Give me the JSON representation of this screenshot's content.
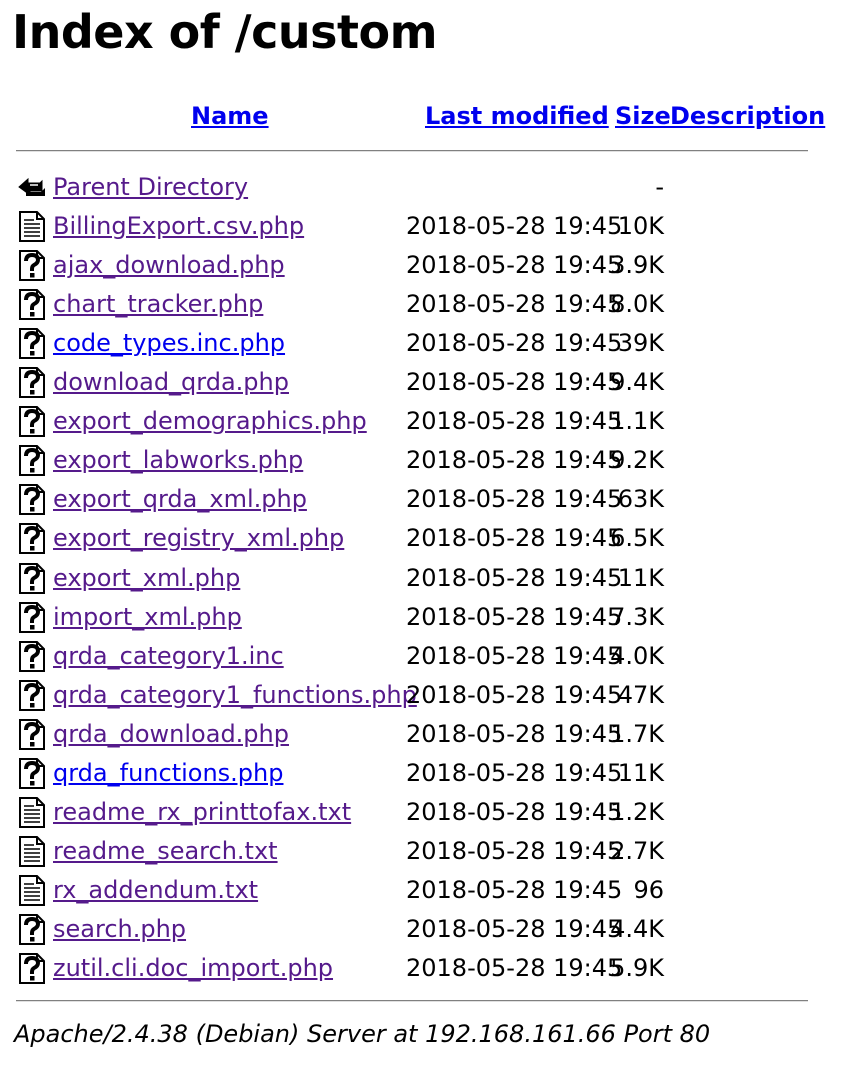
{
  "page": {
    "title": "Index of /custom"
  },
  "columns": {
    "name": "Name",
    "last_modified": "Last modified",
    "size": "Size",
    "description": "Description"
  },
  "parent": {
    "label": "Parent Directory",
    "size": "-",
    "icon": "back-arrow-icon"
  },
  "files": [
    {
      "name": "BillingExport.csv.php",
      "modified": "2018-05-28 19:45",
      "size": "10K",
      "icon": "text-file-icon",
      "state": "visited"
    },
    {
      "name": "ajax_download.php",
      "modified": "2018-05-28 19:45",
      "size": "3.9K",
      "icon": "unknown-file-icon",
      "state": "visited"
    },
    {
      "name": "chart_tracker.php",
      "modified": "2018-05-28 19:45",
      "size": "8.0K",
      "icon": "unknown-file-icon",
      "state": "visited"
    },
    {
      "name": "code_types.inc.php",
      "modified": "2018-05-28 19:45",
      "size": "39K",
      "icon": "unknown-file-icon",
      "state": "fresh"
    },
    {
      "name": "download_qrda.php",
      "modified": "2018-05-28 19:45",
      "size": "9.4K",
      "icon": "unknown-file-icon",
      "state": "visited"
    },
    {
      "name": "export_demographics.php",
      "modified": "2018-05-28 19:45",
      "size": "1.1K",
      "icon": "unknown-file-icon",
      "state": "visited"
    },
    {
      "name": "export_labworks.php",
      "modified": "2018-05-28 19:45",
      "size": "9.2K",
      "icon": "unknown-file-icon",
      "state": "visited"
    },
    {
      "name": "export_qrda_xml.php",
      "modified": "2018-05-28 19:45",
      "size": "63K",
      "icon": "unknown-file-icon",
      "state": "visited"
    },
    {
      "name": "export_registry_xml.php",
      "modified": "2018-05-28 19:45",
      "size": "6.5K",
      "icon": "unknown-file-icon",
      "state": "visited"
    },
    {
      "name": "export_xml.php",
      "modified": "2018-05-28 19:45",
      "size": "11K",
      "icon": "unknown-file-icon",
      "state": "visited"
    },
    {
      "name": "import_xml.php",
      "modified": "2018-05-28 19:45",
      "size": "7.3K",
      "icon": "unknown-file-icon",
      "state": "visited"
    },
    {
      "name": "qrda_category1.inc",
      "modified": "2018-05-28 19:45",
      "size": "4.0K",
      "icon": "unknown-file-icon",
      "state": "visited"
    },
    {
      "name": "qrda_category1_functions.php",
      "modified": "2018-05-28 19:45",
      "size": "47K",
      "icon": "unknown-file-icon",
      "state": "visited"
    },
    {
      "name": "qrda_download.php",
      "modified": "2018-05-28 19:45",
      "size": "1.7K",
      "icon": "unknown-file-icon",
      "state": "visited"
    },
    {
      "name": "qrda_functions.php",
      "modified": "2018-05-28 19:45",
      "size": "11K",
      "icon": "unknown-file-icon",
      "state": "fresh"
    },
    {
      "name": "readme_rx_printtofax.txt",
      "modified": "2018-05-28 19:45",
      "size": "1.2K",
      "icon": "text-file-icon",
      "state": "visited"
    },
    {
      "name": "readme_search.txt",
      "modified": "2018-05-28 19:45",
      "size": "2.7K",
      "icon": "text-file-icon",
      "state": "visited"
    },
    {
      "name": "rx_addendum.txt",
      "modified": "2018-05-28 19:45",
      "size": "96",
      "icon": "text-file-icon",
      "state": "visited"
    },
    {
      "name": "search.php",
      "modified": "2018-05-28 19:45",
      "size": "4.4K",
      "icon": "unknown-file-icon",
      "state": "visited"
    },
    {
      "name": "zutil.cli.doc_import.php",
      "modified": "2018-05-28 19:45",
      "size": "5.9K",
      "icon": "unknown-file-icon",
      "state": "visited"
    }
  ],
  "colors": {
    "link": "#0000ee",
    "visited_link": "#551a8b"
  },
  "footer": {
    "address": "Apache/2.4.38 (Debian) Server at 192.168.161.66 Port 80"
  }
}
